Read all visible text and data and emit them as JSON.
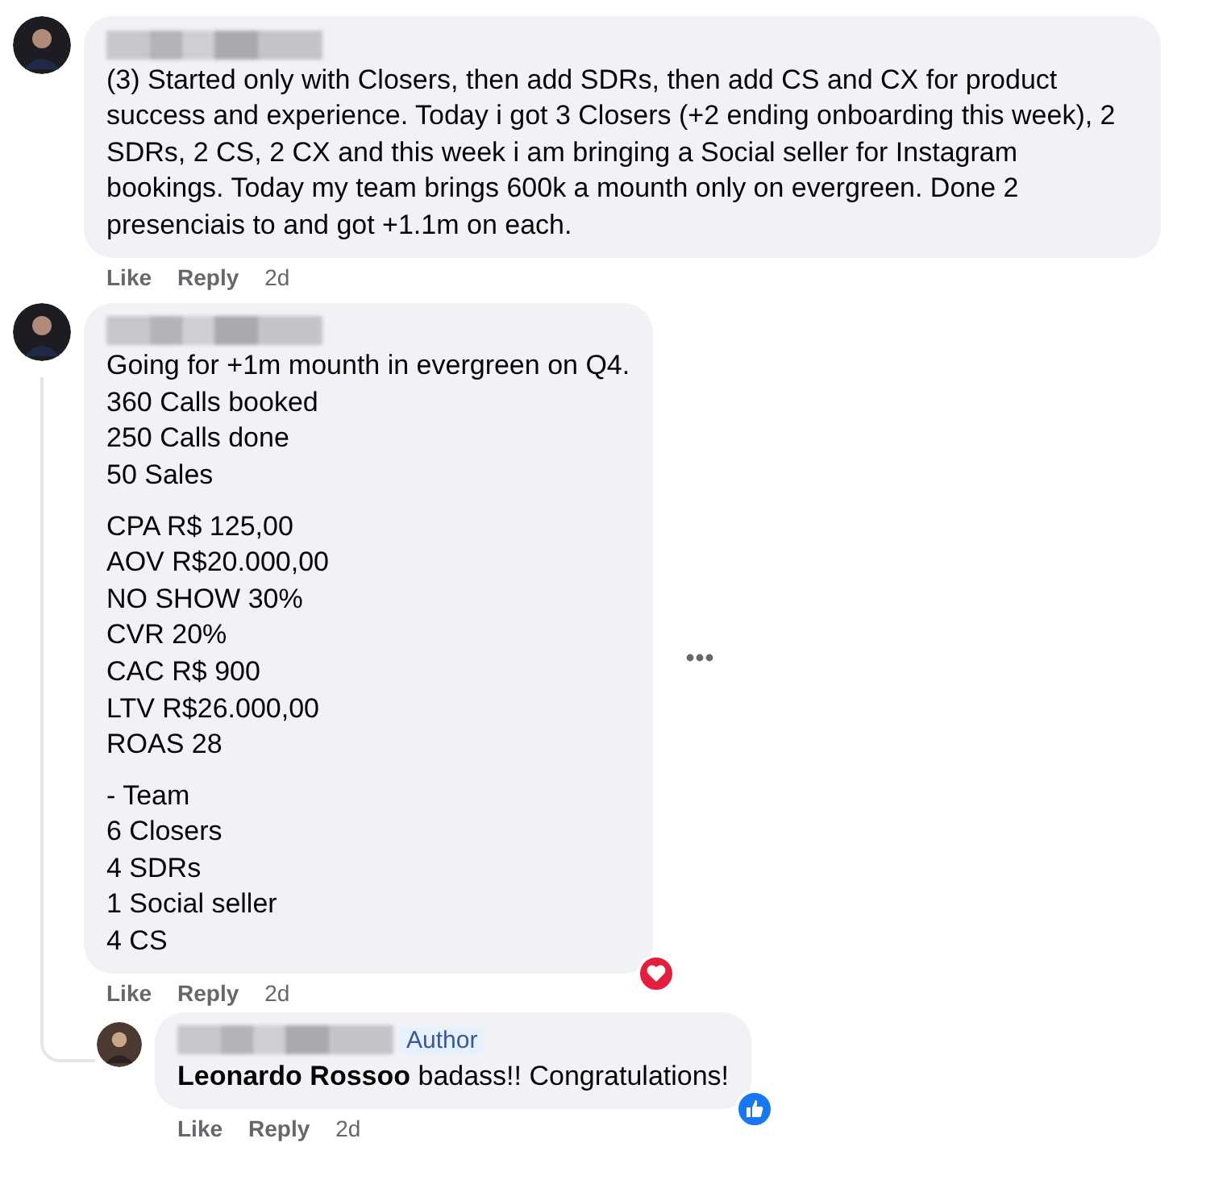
{
  "comments": [
    {
      "author_redacted": true,
      "paragraphs": [
        [
          "(3) Started only with Closers, then add SDRs, then add CS and CX for product success and experience. Today i got 3 Closers (+2 ending onboarding this week), 2 SDRs, 2 CS, 2 CX and this week i am bringing a Social seller for Instagram bookings. Today my team brings 600k a mounth only on evergreen. Done 2 presenciais to and got +1.1m on each."
        ]
      ],
      "actions": [
        "Like",
        "Reply",
        "2d"
      ],
      "more_menu": false,
      "reply": false
    },
    {
      "author_redacted": true,
      "paragraphs": [
        [
          "Going for +1m mounth in evergreen on Q4.",
          "360 Calls booked",
          "250 Calls done",
          "50 Sales"
        ],
        [
          "CPA R$ 125,00",
          "AOV R$20.000,00",
          "NO SHOW 30%",
          "CVR 20%",
          "CAC R$ 900",
          "LTV R$26.000,00",
          "ROAS 28"
        ],
        [
          "- Team",
          "6 Closers",
          "4 SDRs",
          "1 Social seller",
          "4 CS"
        ]
      ],
      "actions": [
        "Like",
        "Reply",
        "2d"
      ],
      "reaction": {
        "kind": "love"
      },
      "more_menu": true,
      "reply": false
    },
    {
      "author_redacted": true,
      "badge": "Author",
      "paragraphs": [
        [
          "**Leonardo Rossoo** badass!! Congratulations!"
        ]
      ],
      "actions": [
        "Like",
        "Reply",
        "2d"
      ],
      "reaction": {
        "kind": "like"
      },
      "more_menu": false,
      "reply": true
    }
  ]
}
